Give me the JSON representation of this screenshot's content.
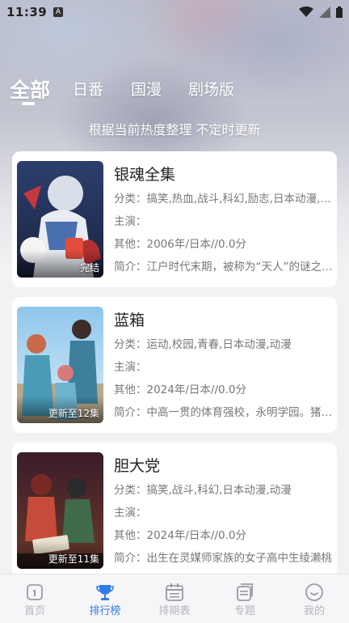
{
  "status_bar": {
    "time": "11:39",
    "notification_icon": "A"
  },
  "top_tabs": [
    "全部",
    "日番",
    "国漫",
    "剧场版"
  ],
  "subtitle": "根据当前热度整理 不定时更新",
  "cards": [
    {
      "title": "银魂全集",
      "category": "分类：搞笑,热血,战斗,科幻,励志,日本动漫,动漫",
      "cast": "主演：",
      "other": "其他：2006年/日本//0.0分",
      "intro": "简介：江户时代末期，被称为“天人”的谜之外星人来袭",
      "badge": "完结"
    },
    {
      "title": "蓝箱",
      "category": "分类：运动,校园,青春,日本动漫,动漫",
      "cast": "主演：",
      "other": "其他：2024年/日本//0.0分",
      "intro": "简介：中高一贯的体育强校，永明学园。猪股大喜是",
      "badge": "更新至12集"
    },
    {
      "title": "胆大党",
      "category": "分类：搞笑,战斗,科幻,日本动漫,动漫",
      "cast": "主演：",
      "other": "其他：2024年/日本//0.0分",
      "intro": "简介：出生在灵媒师家族的女子高中生绫濑桃",
      "badge": "更新至11集"
    }
  ],
  "bottom_nav": [
    {
      "label": "首页",
      "icon": "home-icon"
    },
    {
      "label": "排行榜",
      "icon": "trophy-icon"
    },
    {
      "label": "排期表",
      "icon": "calendar-icon"
    },
    {
      "label": "专题",
      "icon": "topic-icon"
    },
    {
      "label": "我的",
      "icon": "smile-icon"
    }
  ],
  "colors": {
    "accent": "#2f7be8",
    "nav_inactive": "#b5b5bb"
  }
}
